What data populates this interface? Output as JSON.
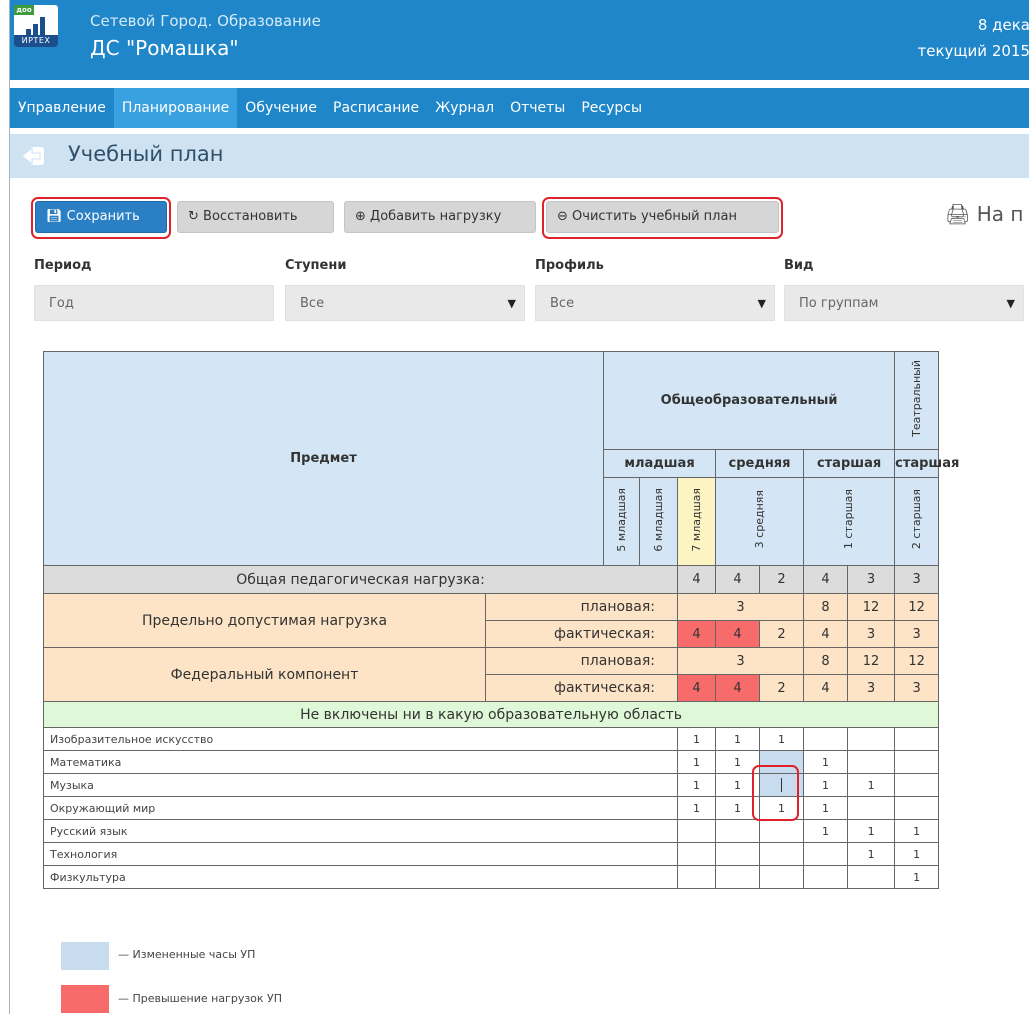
{
  "header": {
    "subtitle": "Сетевой Город. Образование",
    "title": "ДС \"Ромашка\"",
    "logo_badge": "доо",
    "logo_text": "ИРТЕХ",
    "date_partial": "8 дека",
    "year_partial": "текущий 2015"
  },
  "nav": {
    "items": [
      "Управление",
      "Планирование",
      "Обучение",
      "Расписание",
      "Журнал",
      "Отчеты",
      "Ресурсы"
    ],
    "active": "Планирование"
  },
  "page": {
    "title": "Учебный план"
  },
  "toolbar": {
    "save": "Сохранить",
    "restore": "Восстановить",
    "add_load": "Добавить нагрузку",
    "clear": "Очистить учебный план",
    "print": "На п"
  },
  "filters": {
    "period": {
      "label": "Период",
      "value": "Год"
    },
    "levels": {
      "label": "Ступени",
      "value": "Все"
    },
    "profile": {
      "label": "Профиль",
      "value": "Все"
    },
    "view": {
      "label": "Вид",
      "value": "По группам"
    }
  },
  "table": {
    "subject_header": "Предмет",
    "profile_general": "Общеобразовательный",
    "profile_theatre": "Театральный",
    "level_junior": "младшая",
    "level_middle": "средняя",
    "level_senior": "старшая",
    "level_senior2": "старшая",
    "groups": [
      "5 младшая",
      "6 младшая",
      "7 младшая",
      "3 средняя",
      "1 старшая",
      "2 старшая"
    ],
    "total_label": "Общая педагогическая нагрузка:",
    "total_values": [
      "4",
      "4",
      "2",
      "4",
      "3",
      "3"
    ],
    "max_load_label": "Предельно допустимая нагрузка",
    "federal_label": "Федеральный компонент",
    "planned_label": "плановая:",
    "actual_label": "фактическая:",
    "planned_values": [
      "3",
      "8",
      "12",
      "12"
    ],
    "actual_values": [
      "4",
      "4",
      "2",
      "4",
      "3",
      "3"
    ],
    "area_label": "Не включены ни в какую образовательную область",
    "subjects": [
      {
        "name": "Изобразительное искусство",
        "values": [
          "1",
          "1",
          "1",
          "",
          "",
          ""
        ]
      },
      {
        "name": "Математика",
        "values": [
          "1",
          "1",
          "",
          "1",
          "",
          ""
        ]
      },
      {
        "name": "Музыка",
        "values": [
          "1",
          "1",
          "",
          "1",
          "1",
          ""
        ]
      },
      {
        "name": "Окружающий мир",
        "values": [
          "1",
          "1",
          "1",
          "1",
          "",
          ""
        ]
      },
      {
        "name": "Русский язык",
        "values": [
          "",
          "",
          "",
          "1",
          "1",
          "1"
        ]
      },
      {
        "name": "Технология",
        "values": [
          "",
          "",
          "",
          "",
          "1",
          "1"
        ]
      },
      {
        "name": "Физкультура",
        "values": [
          "",
          "",
          "",
          "",
          "",
          "1"
        ]
      }
    ]
  },
  "legend": {
    "changed": "— Измененные часы УП",
    "exceeded": "— Превышение нагрузок УП"
  },
  "colors": {
    "brand_blue": "#1f86c9",
    "changed_hours": "#c8dcf0",
    "exceeded": "#f86b6b",
    "highlight_ring": "#e0232b"
  }
}
